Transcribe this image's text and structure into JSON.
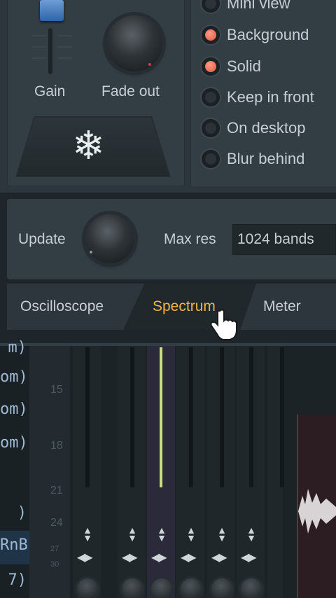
{
  "gain": {
    "label": "Gain"
  },
  "fade_out": {
    "label": "Fade out"
  },
  "freeze": {
    "icon": "snowflake-icon",
    "glyph": "❄"
  },
  "options": [
    {
      "label": "Mini view",
      "selected": false
    },
    {
      "label": "Background",
      "selected": true
    },
    {
      "label": "Solid",
      "selected": true
    },
    {
      "label": "Keep in front",
      "selected": false
    },
    {
      "label": "On desktop",
      "selected": false
    },
    {
      "label": "Blur behind",
      "selected": false
    }
  ],
  "update": {
    "label": "Update"
  },
  "max_res": {
    "label": "Max res",
    "value": "1024 bands"
  },
  "tabs": [
    {
      "label": "Oscilloscope",
      "active": false
    },
    {
      "label": "Spectrum",
      "active": true
    },
    {
      "label": "Meter",
      "active": false
    }
  ],
  "mixer": {
    "list_items": [
      "m)",
      "om)",
      "om)",
      "om)",
      ")",
      "RnB",
      "7)"
    ],
    "scale": [
      "15",
      "18",
      "21",
      "24",
      "27",
      "30"
    ]
  },
  "colors": {
    "accent_tab": "#f0b54a",
    "radio_on": "#e2553f",
    "fader_cap": "#3b74c0",
    "selected_meter": "#c9e07a"
  }
}
